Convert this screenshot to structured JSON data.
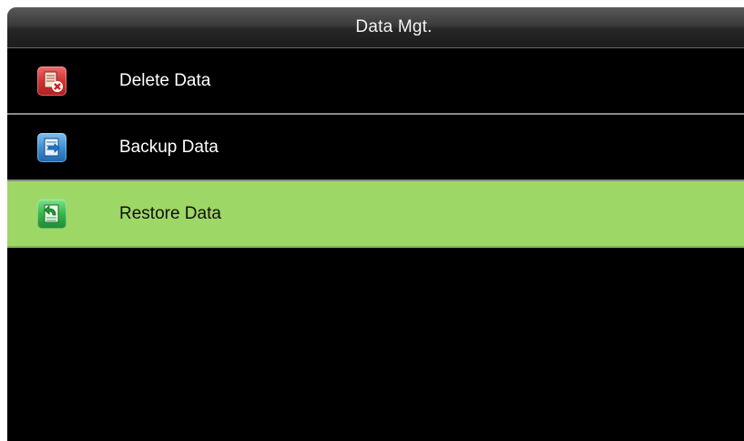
{
  "header": {
    "title": "Data Mgt."
  },
  "menu": {
    "items": [
      {
        "label": "Delete Data",
        "icon": "delete-data-icon",
        "icon_color": "#d23232"
      },
      {
        "label": "Backup Data",
        "icon": "backup-data-icon",
        "icon_color": "#3d8fd6"
      },
      {
        "label": "Restore Data",
        "icon": "restore-data-icon",
        "icon_color": "#35b54a",
        "selected": true
      }
    ]
  },
  "colors": {
    "background": "#000000",
    "selected_row": "#9dd765",
    "divider": "#8a8a8a"
  }
}
